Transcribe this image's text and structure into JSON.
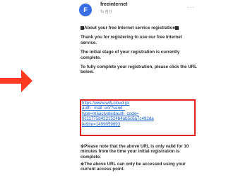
{
  "email": {
    "sender": "freeinternet",
    "recipient": "To 自分",
    "more": "...",
    "avatar_letter": "F",
    "title_text": "About your free Internet service registration",
    "p1": "Thank you for registering to use our free Internet service.",
    "p2": "The initial stage of your registration is currently complete.",
    "p3": "To fully complete your registration, please click the URL below.",
    "link": "https://www.wifi-cloud.jp/\nauth_          mail_en/?send_\ntype=maactvate&auth_code=\n0c11775b4221524b4ab5c6a7c492da\nfe&tm=1499059893",
    "note1": "※Please note that the above URL is only valid for 10 minutes from the time your initial registration is complete.",
    "note2": "※The above URL can only be accessed using your current access point."
  },
  "colors": {
    "arrow": "#ff3b22",
    "highlight_border": "#e02424",
    "link": "#1a5fd0",
    "avatar": "#3b6ee6"
  },
  "icons": {
    "arrow": "right-arrow-icon",
    "avatar": "avatar-icon",
    "more": "more-icon"
  }
}
